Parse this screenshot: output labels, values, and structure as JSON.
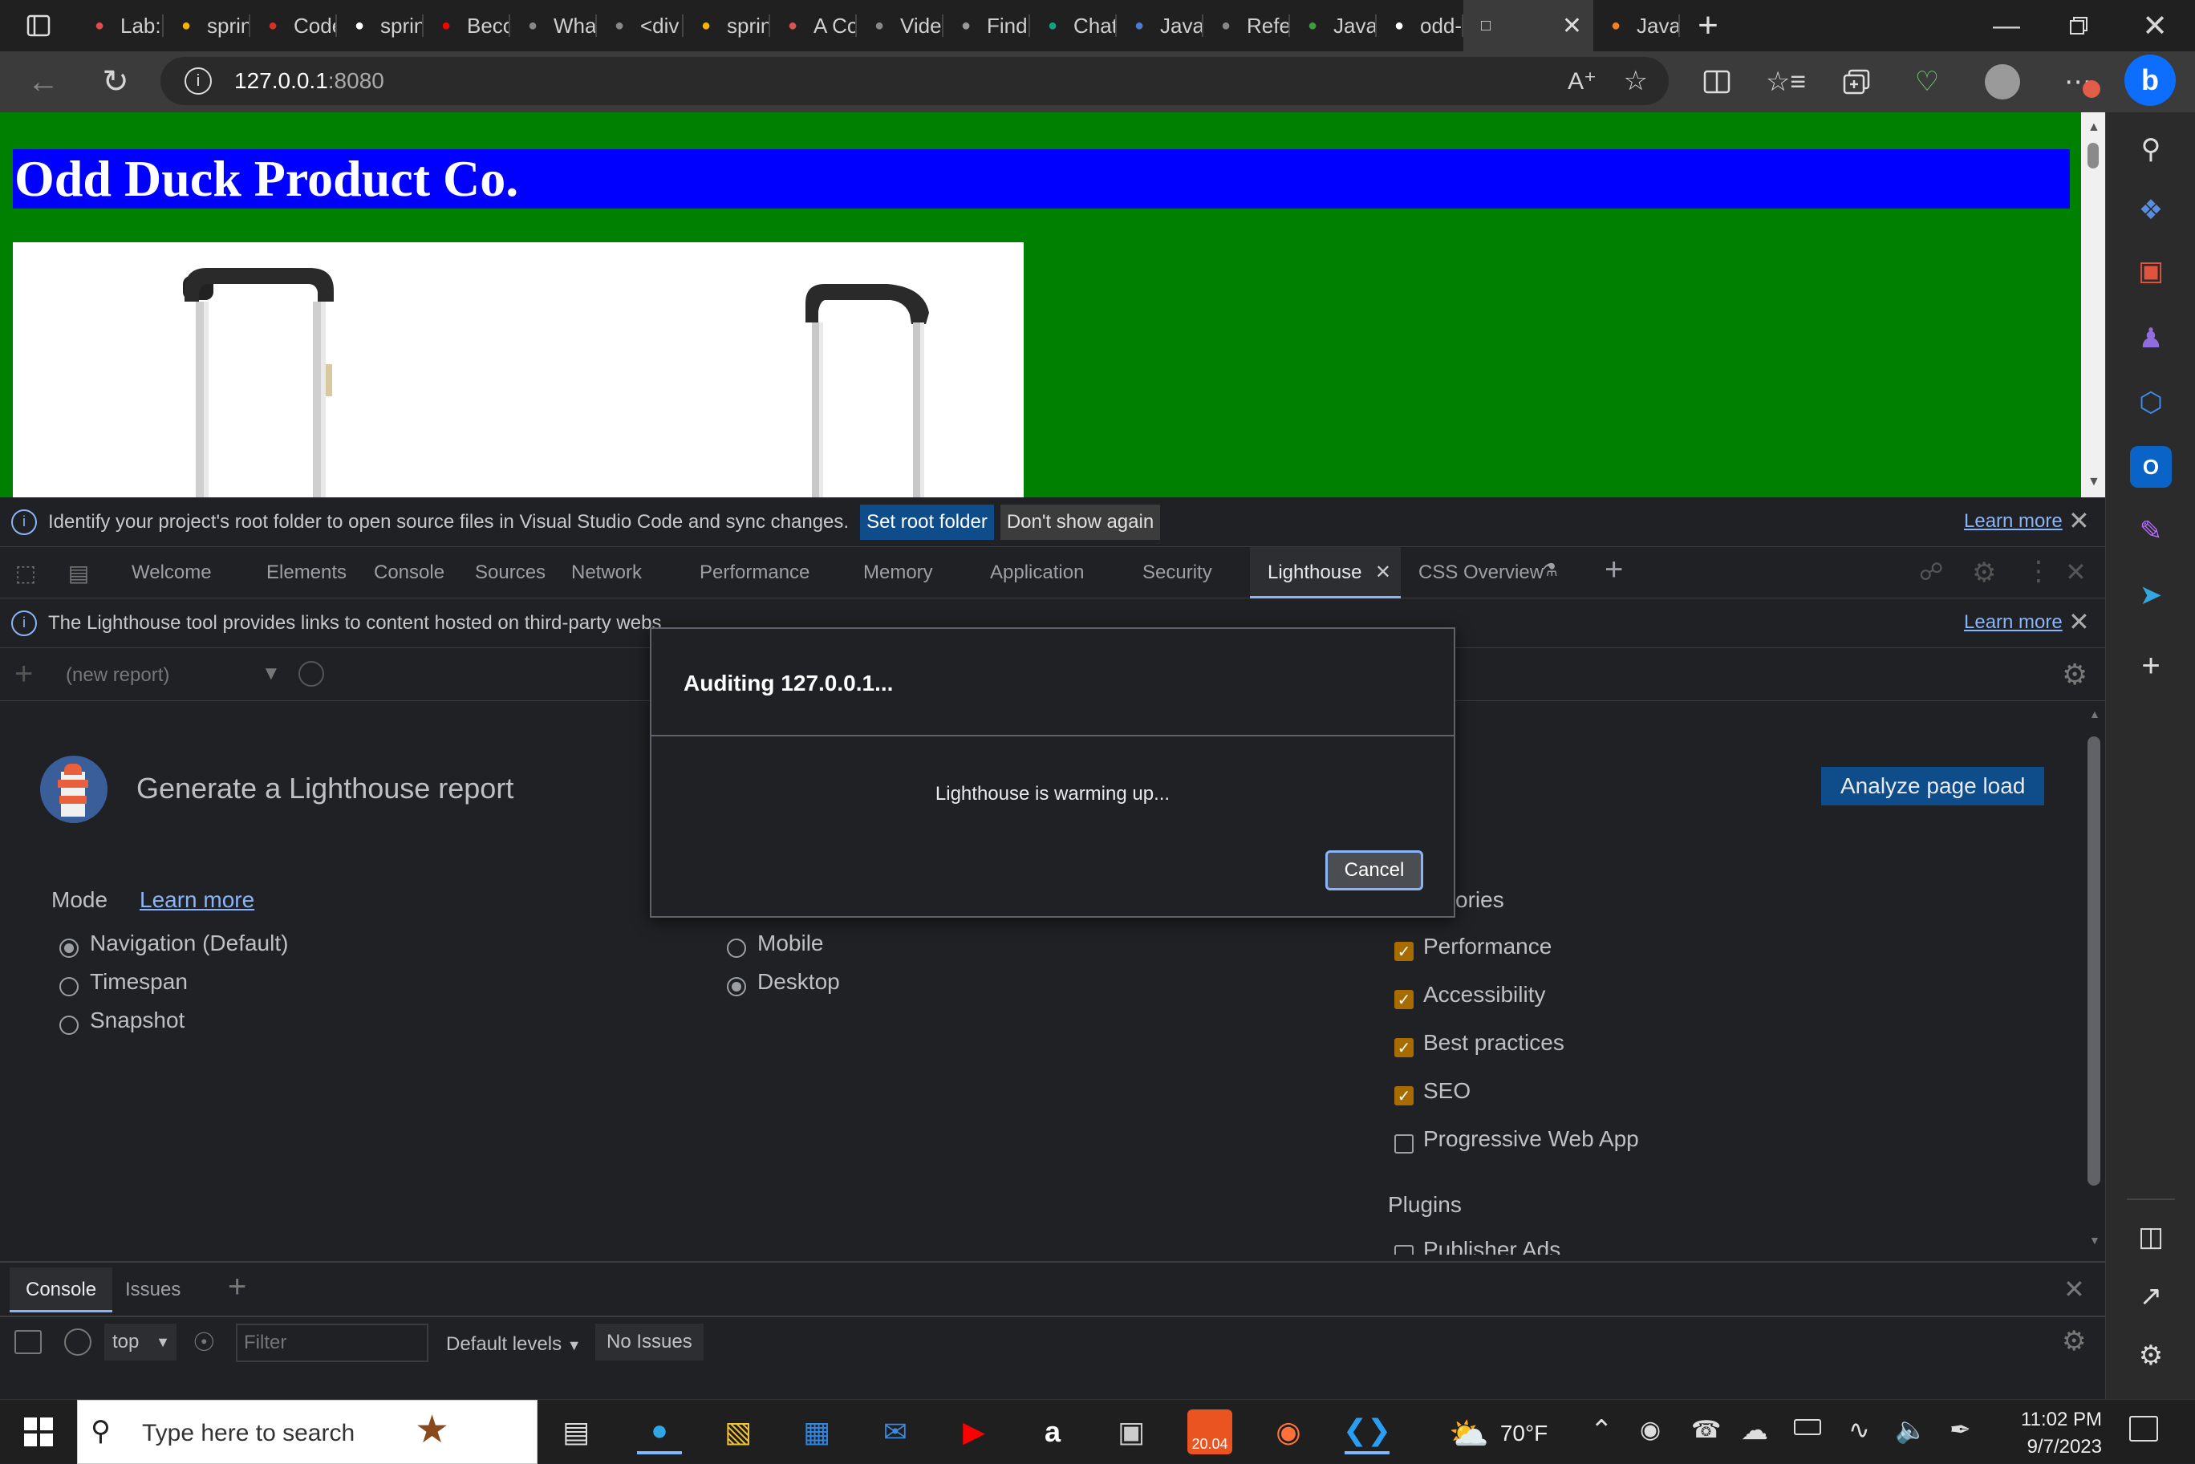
{
  "browser": {
    "tabs": [
      {
        "title": "Lab:",
        "icon": "red-gear-icon",
        "color": "#e34a4a"
      },
      {
        "title": "sprin",
        "icon": "google-drive-icon",
        "color": "#f4b400"
      },
      {
        "title": "Code",
        "icon": "red-dot-icon",
        "color": "#d93025"
      },
      {
        "title": "sprin",
        "icon": "github-icon",
        "color": "#ffffff"
      },
      {
        "title": "Beco",
        "icon": "youtube-icon",
        "color": "#ff0000"
      },
      {
        "title": "Wha",
        "icon": "medium-icon",
        "color": "#888888"
      },
      {
        "title": "<div",
        "icon": "medium-icon",
        "color": "#888888"
      },
      {
        "title": "sprin",
        "icon": "google-drive-icon",
        "color": "#f4b400"
      },
      {
        "title": "A Co",
        "icon": "asterisk-icon",
        "color": "#d9534f"
      },
      {
        "title": "Vide",
        "icon": "medium-icon",
        "color": "#888888"
      },
      {
        "title": "Find",
        "icon": "page-thumbnail-icon",
        "color": "#999999"
      },
      {
        "title": "Chat",
        "icon": "chatgpt-icon",
        "color": "#10a37f"
      },
      {
        "title": "Java",
        "icon": "pen-icon",
        "color": "#4a7bd0"
      },
      {
        "title": "Refe",
        "icon": "medium-icon",
        "color": "#888888"
      },
      {
        "title": "Java",
        "icon": "w-icon",
        "color": "#3c9b3c"
      },
      {
        "title": "odd-",
        "icon": "github-icon",
        "color": "#ffffff"
      }
    ],
    "active_tab": {
      "title": "",
      "icon": "page-icon"
    },
    "last_tab": {
      "title": "Java",
      "icon": "stackoverflow-icon",
      "color": "#f48024"
    },
    "url_host": "127.0.0.1",
    "url_port": ":8080"
  },
  "page": {
    "heading": "Odd Duck Product Co."
  },
  "devtools": {
    "vscode_bar": {
      "message": "Identify your project's root folder to open source files in Visual Studio Code and sync changes.",
      "set_root": "Set root folder",
      "dont_show": "Don't show again",
      "learn_more": "Learn more"
    },
    "tabs": [
      "Welcome",
      "Elements",
      "Console",
      "Sources",
      "Network",
      "Performance",
      "Memory",
      "Application",
      "Security",
      "Lighthouse",
      "CSS Overview"
    ],
    "active_tab": "Lighthouse",
    "lh_notice": {
      "message": "The Lighthouse tool provides links to content hosted on third-party webs",
      "learn_more": "Learn more"
    },
    "report_select": "(new report)",
    "lighthouse": {
      "title": "Generate a Lighthouse report",
      "analyze": "Analyze page load",
      "mode_label": "Mode",
      "mode_learn": "Learn more",
      "modes": [
        {
          "label": "Navigation (Default)",
          "checked": true
        },
        {
          "label": "Timespan",
          "checked": false
        },
        {
          "label": "Snapshot",
          "checked": false
        }
      ],
      "devices": [
        {
          "label": "Mobile",
          "checked": false
        },
        {
          "label": "Desktop",
          "checked": true
        }
      ],
      "categories_label_tail": "ories",
      "categories": [
        {
          "label": "Performance",
          "checked": true
        },
        {
          "label": "Accessibility",
          "checked": true
        },
        {
          "label": "Best practices",
          "checked": true
        },
        {
          "label": "SEO",
          "checked": true
        },
        {
          "label": "Progressive Web App",
          "checked": false
        }
      ],
      "plugins_label": "Plugins",
      "plugins": [
        {
          "label": "Publisher Ads",
          "checked": false
        }
      ]
    },
    "dialog": {
      "title": "Auditing 127.0.0.1...",
      "message": "Lighthouse is warming up...",
      "cancel": "Cancel"
    },
    "drawer": {
      "tabs": [
        "Console",
        "Issues"
      ],
      "context": "top",
      "filter_placeholder": "Filter",
      "levels": "Default levels",
      "issues": "No Issues"
    }
  },
  "taskbar": {
    "search_placeholder": "Type here to search",
    "weather": "70°F",
    "time": "11:02 PM",
    "date": "9/7/2023",
    "ubuntu_badge": "20.04"
  }
}
